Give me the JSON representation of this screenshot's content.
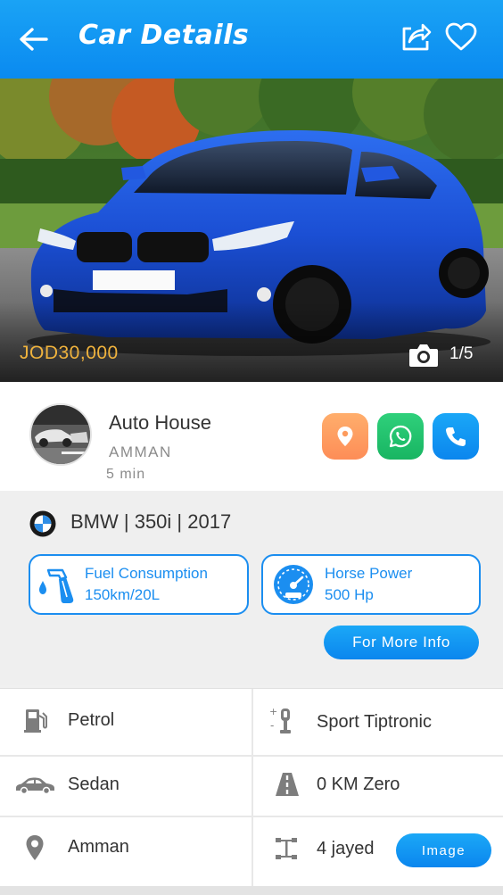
{
  "header": {
    "title": "Car Details",
    "background": "#0f94f2"
  },
  "listing": {
    "price": "JOD30,000",
    "photo_counter": "1/5",
    "photo_current": 1,
    "photo_total": 5
  },
  "dealer": {
    "name": "Auto House",
    "city": "AMMAN",
    "posted": "5 min"
  },
  "actions": {
    "location_color": "#fd9b5d",
    "whatsapp_color": "#22c16c",
    "call_color": "#0f94f2"
  },
  "car": {
    "title": "BMW | 350i | 2017",
    "fuel_label": "Fuel Consumption",
    "fuel_value": "150km/20L",
    "hp_label": "Horse Power",
    "hp_value": "500 Hp",
    "more_button": "For More Info"
  },
  "features": [
    {
      "icon": "fuel-pump-icon",
      "text": "Petrol"
    },
    {
      "icon": "gear-shift-icon",
      "text": "Sport Tiptronic"
    },
    {
      "icon": "car-icon",
      "text": "Sedan"
    },
    {
      "icon": "road-icon",
      "text": "0 KM  Zero"
    },
    {
      "icon": "location-pin-icon",
      "text": "Amman"
    },
    {
      "icon": "rim-icon",
      "text": "4 jayed"
    }
  ],
  "image_button": "Image",
  "colors": {
    "accent": "#1b8ef0",
    "price": "#f0b33d"
  }
}
